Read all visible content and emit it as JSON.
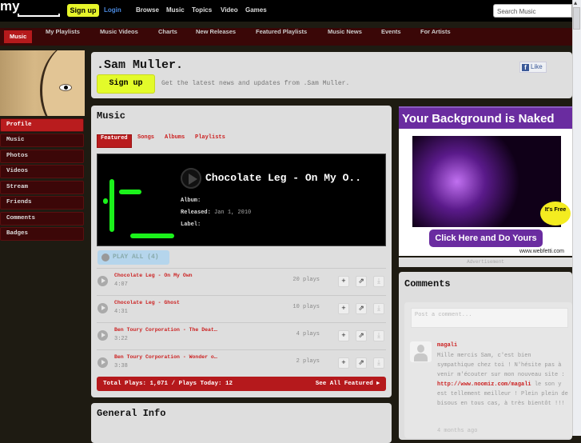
{
  "topbar": {
    "logo": "my",
    "signup": "Sign up",
    "login": "Login",
    "links": [
      "Browse",
      "Music",
      "Topics",
      "Video",
      "Games"
    ],
    "search_placeholder": "Search Music"
  },
  "nav": [
    "Music",
    "My Playlists",
    "Music Videos",
    "Charts",
    "New Releases",
    "Featured Playlists",
    "Music News",
    "Events",
    "For Artists"
  ],
  "sidebar": [
    "Profile",
    "Music",
    "Photos",
    "Videos",
    "Stream",
    "Friends",
    "Comments",
    "Badges"
  ],
  "header": {
    "artist": ".Sam Muller.",
    "signup": "Sign up",
    "tagline": "Get the latest news and updates from .Sam Muller.",
    "like": "Like"
  },
  "music": {
    "title": "Music",
    "tabs": [
      "Featured",
      "Songs",
      "Albums",
      "Playlists"
    ],
    "featured": {
      "label": "",
      "title": "Chocolate Leg - On My O..",
      "album_label": "Album:",
      "album": "",
      "released_label": "Released:",
      "released": "Jan 1, 2010",
      "label_label": "Label:"
    },
    "play_all": "PLAY ALL (4)",
    "songs": [
      {
        "title": "Chocolate Leg - On My Own",
        "duration": "4:07",
        "plays": "20 plays"
      },
      {
        "title": "Chocolate Leg - Ghost",
        "duration": "4:31",
        "plays": "10 plays"
      },
      {
        "title": "Ben Toury Corporation - The Deat…",
        "duration": "3:22",
        "plays": "4 plays"
      },
      {
        "title": "Ben Toury Corporation - Wonder o…",
        "duration": "3:38",
        "plays": "2 plays"
      }
    ],
    "total": "Total Plays: 1,071 / Plays Today: 12",
    "see_all": "See All Featured ▸"
  },
  "general_info": {
    "title": "General Info"
  },
  "ad": {
    "headline": "Your Background is Naked",
    "button": "Click Here and Do Yours",
    "url": "www.webfetti.com",
    "badge": "It's Free",
    "caption": "Advertisement"
  },
  "comments": {
    "title": "Comments",
    "placeholder": "Post a comment...",
    "items": [
      {
        "user": "magali",
        "text1": "Mille mercis Sam, c'est bien sympathique chez toi ! N'hésite pas à venir m'écouter sur mon nouveau site : ",
        "link": "http://www.noomiz.com/magali",
        "text2": " le son y est tellement meilleur ! Plein plein de bisous en tous cas, à très bientôt !!!",
        "time": "4 months ago"
      }
    ]
  },
  "colors": {
    "accent": "#b91c1e",
    "signup": "#e3fb2a",
    "nav_bg": "#3a0707"
  }
}
